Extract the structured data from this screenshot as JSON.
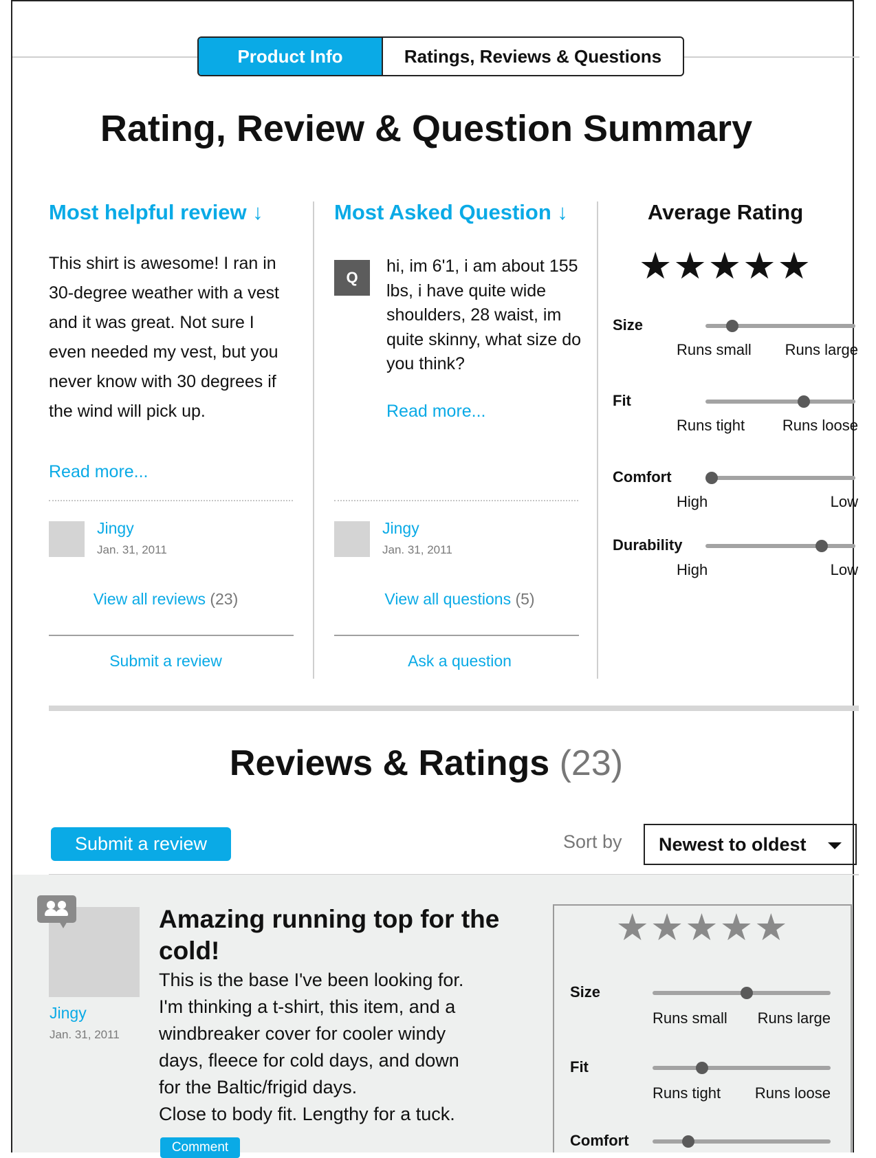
{
  "tabs": {
    "active": "Product Info",
    "inactive": "Ratings, Reviews & Questions"
  },
  "summary": {
    "title": "Rating, Review & Question Summary",
    "helpful": {
      "heading": "Most helpful review ↓",
      "text": "This shirt is awesome! I ran in 30-degree weather with a vest and it was great. Not sure I even needed my vest, but you never know with 30 degrees if the wind will pick up.",
      "read_more": "Read more...",
      "author": "Jingy",
      "date": "Jan. 31, 2011",
      "view_all": "View all reviews",
      "view_all_count": "(23)",
      "action": "Submit a review"
    },
    "question": {
      "heading": "Most Asked Question ↓",
      "badge": "Q",
      "text": "hi, im 6'1, i am about 155 lbs, i have quite wide shoulders, 28 waist, im quite skinny, what size do you think?",
      "read_more": "Read more...",
      "author": "Jingy",
      "date": "Jan. 31, 2011",
      "view_all": "View all questions",
      "view_all_count": "(5)",
      "action": "Ask a question"
    },
    "average": {
      "heading": "Average Rating",
      "stars": "★★★★★",
      "rating": 5,
      "sliders": [
        {
          "label": "Size",
          "left": "Runs small",
          "right": "Runs large",
          "value": 0.15
        },
        {
          "label": "Fit",
          "left": "Runs tight",
          "right": "Runs loose",
          "value": 0.67
        },
        {
          "label": "Comfort",
          "left": "High",
          "right": "Low",
          "value": 0.0
        },
        {
          "label": "Durability",
          "left": "High",
          "right": "Low",
          "value": 0.8
        }
      ]
    }
  },
  "reviews": {
    "title": "Reviews & Ratings",
    "count": "(23)",
    "submit_button": "Submit a review",
    "sort_label": "Sort by",
    "sort_value": "Newest to oldest",
    "item": {
      "author": "Jingy",
      "date": "Jan. 31, 2011",
      "title": "Amazing running top for the cold!",
      "body_lines": [
        "This is the base I've been looking for.",
        "I'm thinking a t-shirt, this item, and a",
        "windbreaker cover for cooler windy",
        "days, fleece for cold days, and down",
        "for the Baltic/frigid days.",
        "Close to body fit. Lengthy for a tuck."
      ],
      "comment_button": "Comment",
      "stars": "★★★★★",
      "sliders": [
        {
          "label": "Size",
          "left": "Runs small",
          "right": "Runs large",
          "value": 0.53
        },
        {
          "label": "Fit",
          "left": "Runs tight",
          "right": "Runs loose",
          "value": 0.26
        },
        {
          "label": "Comfort",
          "left": "",
          "right": "",
          "value": 0.18
        }
      ]
    }
  },
  "colors": {
    "accent": "#0aaae6",
    "track": "#a3a3a3",
    "knob": "#5a5a5a",
    "card_bg": "#eef0ef",
    "placeholder": "#d4d4d4"
  }
}
